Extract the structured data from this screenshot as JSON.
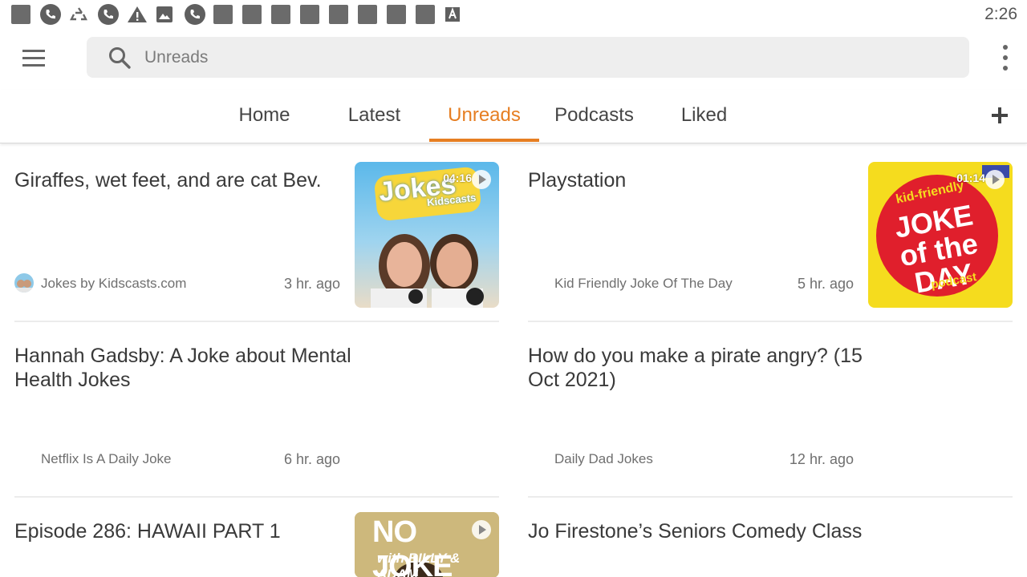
{
  "status_bar": {
    "time": "2:26",
    "icons": [
      "square-icon",
      "phone-icon",
      "recycle-icon",
      "phone-icon",
      "warning-icon",
      "image-icon",
      "phone-icon",
      "square-icon",
      "square-icon",
      "square-icon",
      "square-icon",
      "square-icon",
      "square-icon",
      "square-icon",
      "square-icon",
      "font-a-icon"
    ]
  },
  "search": {
    "placeholder": "Unreads"
  },
  "tabs": [
    {
      "label": "Home",
      "active": false
    },
    {
      "label": "Latest",
      "active": false
    },
    {
      "label": "Unreads",
      "active": true
    },
    {
      "label": "Podcasts",
      "active": false
    },
    {
      "label": "Liked",
      "active": false
    }
  ],
  "accent_color": "#e67e22",
  "feed": [
    {
      "title": "Giraffes, wet feet, and are cat Bev.",
      "source": "Jokes by Kidscasts.com",
      "time": "3 hr. ago",
      "duration": "04:16",
      "thumb_text": "Jokes",
      "thumb_subtext": "Kidscasts"
    },
    {
      "title": "Playstation",
      "source": "Kid Friendly Joke Of The Day",
      "time": "5 hr. ago",
      "duration": "01:14",
      "thumb_text": "JOKE of the DAY",
      "thumb_subtext": "kid-friendly",
      "thumb_footer": "podcast"
    },
    {
      "title": "Hannah Gadsby: A Joke about Mental Health Jokes",
      "source": "Netflix Is A Daily Joke",
      "time": "6 hr. ago"
    },
    {
      "title": "How do you make a pirate angry? (15 Oct 2021)",
      "source": "Daily Dad Jokes",
      "time": "12 hr. ago"
    },
    {
      "title": "Episode 286: HAWAII PART 1",
      "thumb_text": "NO JOKE",
      "thumb_subtext": "with BILLY & ADAM"
    },
    {
      "title": "Jo Firestone’s Seniors Comedy Class"
    }
  ]
}
